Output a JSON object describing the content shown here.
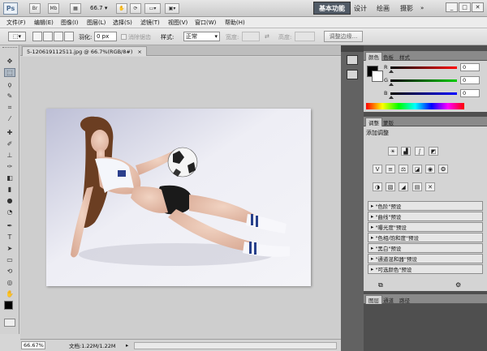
{
  "title_bar": {
    "logo": "Ps",
    "icons": [
      "Br",
      "Mb"
    ],
    "zoom": "66.7",
    "workspaces": [
      "基本功能",
      "设计",
      "绘画",
      "摄影"
    ],
    "window_controls": [
      "_",
      "□",
      "✕"
    ]
  },
  "menu": [
    "文件(F)",
    "编辑(E)",
    "图像(I)",
    "图层(L)",
    "选择(S)",
    "滤镜(T)",
    "视图(V)",
    "窗口(W)",
    "帮助(H)"
  ],
  "options": {
    "feather_label": "羽化:",
    "feather_value": "0 px",
    "antialias_label": "消除锯齿",
    "style_label": "样式:",
    "style_value": "正常",
    "width_label": "宽度:",
    "height_label": "高度:",
    "refine_edge": "调整边缘..."
  },
  "document": {
    "tab_title": "5-120619112511.jpg @ 66.7%(RGB/8#)",
    "close": "×"
  },
  "status": {
    "zoom": "66.67%",
    "doc_info": "文档:1.22M/1.22M"
  },
  "color_panel": {
    "tabs": [
      "颜色",
      "色板",
      "样式"
    ],
    "channels": [
      {
        "label": "R",
        "value": "0"
      },
      {
        "label": "G",
        "value": "0"
      },
      {
        "label": "B",
        "value": "0"
      }
    ]
  },
  "adjustments_panel": {
    "tabs": [
      "调整",
      "蒙版"
    ],
    "heading": "添加调整",
    "presets": [
      "\"色阶\"预设",
      "\"曲线\"预设",
      "\"曝光度\"预设",
      "\"色相/饱和度\"预设",
      "\"黑白\"预设",
      "\"通道混和器\"预设",
      "\"可选颜色\"预设"
    ]
  },
  "layers_panel": {
    "tabs": [
      "图层",
      "通道",
      "路径"
    ]
  },
  "colors": {
    "workspace_active": "#505a66",
    "panel_dark": "#4f4f4f",
    "panel_light": "#d4d4d4"
  }
}
